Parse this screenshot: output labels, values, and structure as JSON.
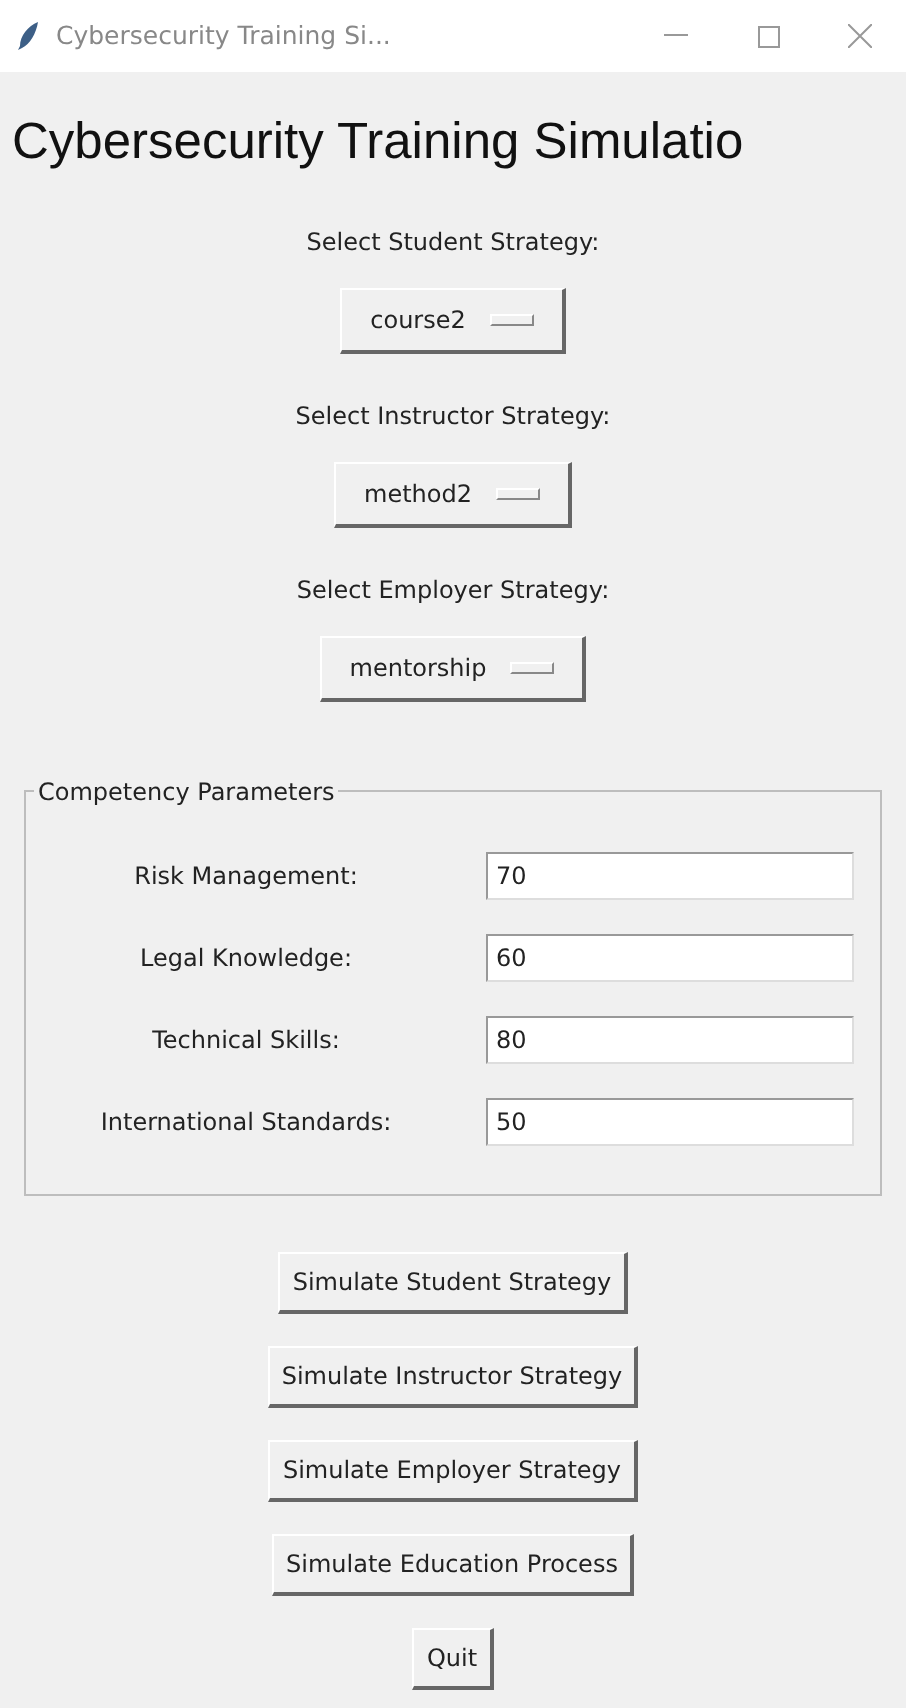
{
  "window": {
    "title": "Cybersecurity Training Si..."
  },
  "heading": "Cybersecurity Training Simulatio",
  "selectors": [
    {
      "label": "Select Student Strategy:",
      "value": "course2"
    },
    {
      "label": "Select Instructor Strategy:",
      "value": "method2"
    },
    {
      "label": "Select Employer Strategy:",
      "value": "mentorship"
    }
  ],
  "competency_parameters": {
    "title": "Competency Parameters",
    "fields": [
      {
        "label": "Risk Management:",
        "value": "70"
      },
      {
        "label": "Legal Knowledge:",
        "value": "60"
      },
      {
        "label": "Technical Skills:",
        "value": "80"
      },
      {
        "label": "International Standards:",
        "value": "50"
      }
    ]
  },
  "buttons": [
    "Simulate Student Strategy",
    "Simulate Instructor Strategy",
    "Simulate Employer Strategy",
    "Simulate Education Process",
    "Quit"
  ]
}
